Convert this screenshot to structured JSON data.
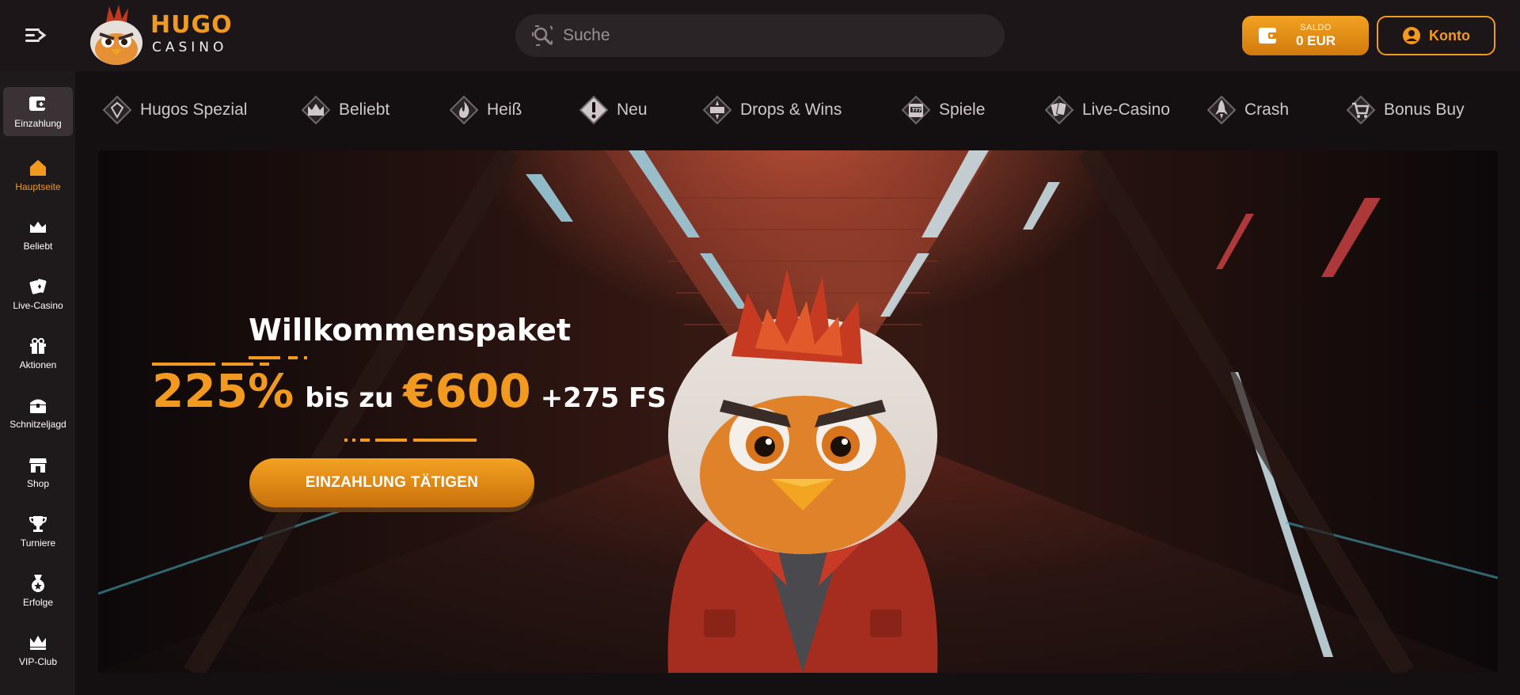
{
  "header": {
    "logo_title": "HUGO",
    "logo_subtitle": "CASINO",
    "search_placeholder": "Suche",
    "balance_label": "SALDO",
    "balance_value": "0 EUR",
    "account_label": "Konto"
  },
  "sidebar": {
    "items": [
      {
        "label": "Einzahlung",
        "icon": "deposit-icon"
      },
      {
        "label": "Hauptseite",
        "icon": "home-icon"
      },
      {
        "label": "Beliebt",
        "icon": "crown-icon"
      },
      {
        "label": "Live-Casino",
        "icon": "cards-icon"
      },
      {
        "label": "Aktionen",
        "icon": "gift-icon"
      },
      {
        "label": "Schnitzeljagd",
        "icon": "treasure-chest-icon"
      },
      {
        "label": "Shop",
        "icon": "shop-icon"
      },
      {
        "label": "Turniere",
        "icon": "trophy-icon"
      },
      {
        "label": "Erfolge",
        "icon": "medal-icon"
      },
      {
        "label": "VIP-Club",
        "icon": "vip-crown-icon"
      }
    ],
    "active_index": 1
  },
  "categories": [
    {
      "label": "Hugos Spezial",
      "icon": "diamond-icon"
    },
    {
      "label": "Beliebt",
      "icon": "crown-icon"
    },
    {
      "label": "Heiß",
      "icon": "flame-icon"
    },
    {
      "label": "Neu",
      "icon": "exclamation-icon"
    },
    {
      "label": "Drops & Wins",
      "icon": "drops-wins-icon"
    },
    {
      "label": "Spiele",
      "icon": "slot-machine-icon"
    },
    {
      "label": "Live-Casino",
      "icon": "cards-icon"
    },
    {
      "label": "Crash",
      "icon": "rocket-icon"
    },
    {
      "label": "Bonus Buy",
      "icon": "shopping-cart-icon"
    }
  ],
  "banner": {
    "title": "Willkommenspaket",
    "percent": "225%",
    "middle": "bis zu",
    "amount": "€600",
    "free_spins": "+275 FS",
    "cta_label": "EINZAHLUNG TÄTIGEN"
  },
  "colors": {
    "accent": "#f29a1f",
    "background": "#141011",
    "sidebar": "#1e191b"
  }
}
